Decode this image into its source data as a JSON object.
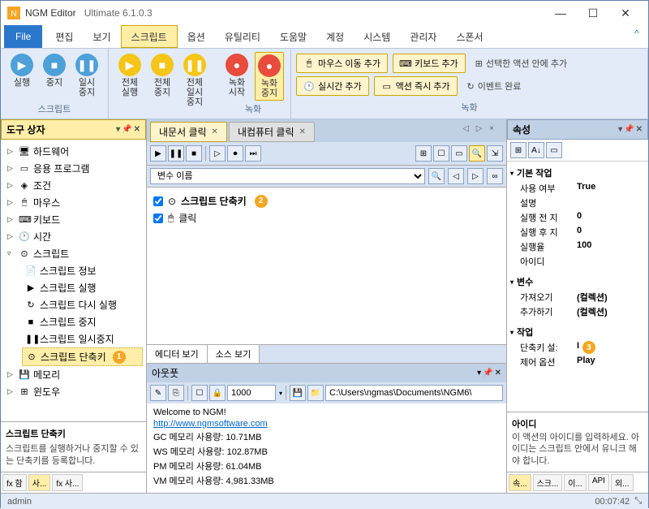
{
  "titlebar": {
    "app": "NGM Editor",
    "version": "Ultimate 6.1.0.3"
  },
  "menu": {
    "file": "File",
    "items": [
      "편집",
      "보기",
      "스크립트",
      "옵션",
      "유틸리티",
      "도움말",
      "계정",
      "시스템",
      "관리자",
      "스폰서"
    ],
    "active_index": 2
  },
  "ribbon": {
    "group1_label": "스크립트",
    "buttons1": [
      {
        "label": "실행",
        "color": "blue",
        "symbol": "▶"
      },
      {
        "label": "중지",
        "color": "blue",
        "symbol": "■"
      },
      {
        "label": "일시 중지",
        "color": "blue",
        "symbol": "❚❚"
      }
    ],
    "buttons2": [
      {
        "label": "전체\n실행",
        "color": "yellow",
        "symbol": "▶"
      },
      {
        "label": "전체\n중지",
        "color": "yellow",
        "symbol": "■"
      },
      {
        "label": "전체\n일시 중지",
        "color": "yellow",
        "symbol": "❚❚"
      }
    ],
    "record_label": "녹화",
    "rec1": "녹화\n시작",
    "rec2": "녹화\n중지",
    "pills": [
      {
        "label": "마우스 이동 추가"
      },
      {
        "label": "키보드 추가"
      },
      {
        "label": "실시간 추가"
      },
      {
        "label": "액션 즉시 추가"
      }
    ],
    "text_actions": [
      "선택한 액션 안에 추가",
      "이벤트 완료"
    ]
  },
  "toolbox": {
    "header": "도구 상자",
    "groups": [
      {
        "chevron": "▷",
        "icon": "🖥",
        "label": "하드웨어"
      },
      {
        "chevron": "▷",
        "icon": "▭",
        "label": "응용 프로그램"
      },
      {
        "chevron": "▷",
        "icon": "◈",
        "label": "조건"
      },
      {
        "chevron": "▷",
        "icon": "🖱",
        "label": "마우스"
      },
      {
        "chevron": "▷",
        "icon": "⌨",
        "label": "키보드"
      },
      {
        "chevron": "▷",
        "icon": "🕐",
        "label": "시간"
      },
      {
        "chevron": "▿",
        "icon": "⊙",
        "label": "스크립트",
        "children": [
          {
            "icon": "📄",
            "label": "스크립트 정보"
          },
          {
            "icon": "▶",
            "label": "스크립트 실행"
          },
          {
            "icon": "↻",
            "label": "스크립트 다시 실행"
          },
          {
            "icon": "■",
            "label": "스크립트 중지"
          },
          {
            "icon": "❚❚",
            "label": "스크립트 일시중지"
          },
          {
            "icon": "⊙",
            "label": "스크립트 단축키",
            "selected": true,
            "badge": "1"
          }
        ]
      },
      {
        "chevron": "▷",
        "icon": "💾",
        "label": "메모리"
      },
      {
        "chevron": "▷",
        "icon": "⊞",
        "label": "윈도우"
      }
    ],
    "help_title": "스크립트 단축키",
    "help_desc": "스크립트를 실행하거나 중지할 수 있는 단축키를 등록합니다.",
    "tabs": [
      {
        "label": "fx 함",
        "active": false
      },
      {
        "label": "사...",
        "active": true
      },
      {
        "label": "fx 사...",
        "active": false
      }
    ]
  },
  "docs": {
    "tabs": [
      {
        "label": "내문서 클릭",
        "active": true
      },
      {
        "label": "내컴퓨터 클릭",
        "active": false
      }
    ],
    "nav": "◁  ▷  ×"
  },
  "editor": {
    "var_dropdown": "변수 이름",
    "actions": [
      {
        "label": "스크립트 단축키",
        "badge": "2"
      },
      {
        "label": "클릭"
      }
    ],
    "tab1": "에디터 보기",
    "tab2": "소스 보기"
  },
  "output": {
    "header": "아웃풋",
    "count": "1000",
    "path": "C:\\Users\\ngmas\\Documents\\NGM6\\",
    "lines": [
      {
        "text": "Welcome to NGM!"
      },
      {
        "link": "http://www.ngmsoftware.com"
      },
      {
        "text": "GC 메모리 사용량: 10.71MB"
      },
      {
        "text": "WS 메모리 사용량: 102.87MB"
      },
      {
        "text": "PM 메모리 사용량: 61.04MB"
      },
      {
        "text": "VM 메모리 사용량: 4,981.33MB"
      }
    ]
  },
  "props": {
    "header": "속성",
    "groups": [
      {
        "title": "기본 작업",
        "rows": [
          {
            "k": "사용 여부",
            "v": "True"
          },
          {
            "k": "설명",
            "v": ""
          },
          {
            "k": "실행 전 지",
            "v": "0"
          },
          {
            "k": "실행 후 지",
            "v": "0"
          },
          {
            "k": "실행율",
            "v": "100"
          },
          {
            "k": "아이디",
            "v": ""
          }
        ]
      },
      {
        "title": "변수",
        "rows": [
          {
            "k": "가져오기",
            "v": "(컬렉션)"
          },
          {
            "k": "추가하기",
            "v": "(컬렉션)"
          }
        ]
      },
      {
        "title": "작업",
        "rows": [
          {
            "k": "단축키 설:",
            "v": "I",
            "badge": "3"
          },
          {
            "k": "제어 옵션",
            "v": "Play"
          }
        ]
      }
    ],
    "help_title": "아이디",
    "help_desc": "이 액션의 아이디를 입력하세요. 아이디는 스크립트 안에서 유니크 해야 합니다.",
    "bottom_tabs": [
      "속...",
      "스크...",
      "이...",
      "API",
      "외..."
    ]
  },
  "status": {
    "user": "admin",
    "time": "00:07:42"
  }
}
